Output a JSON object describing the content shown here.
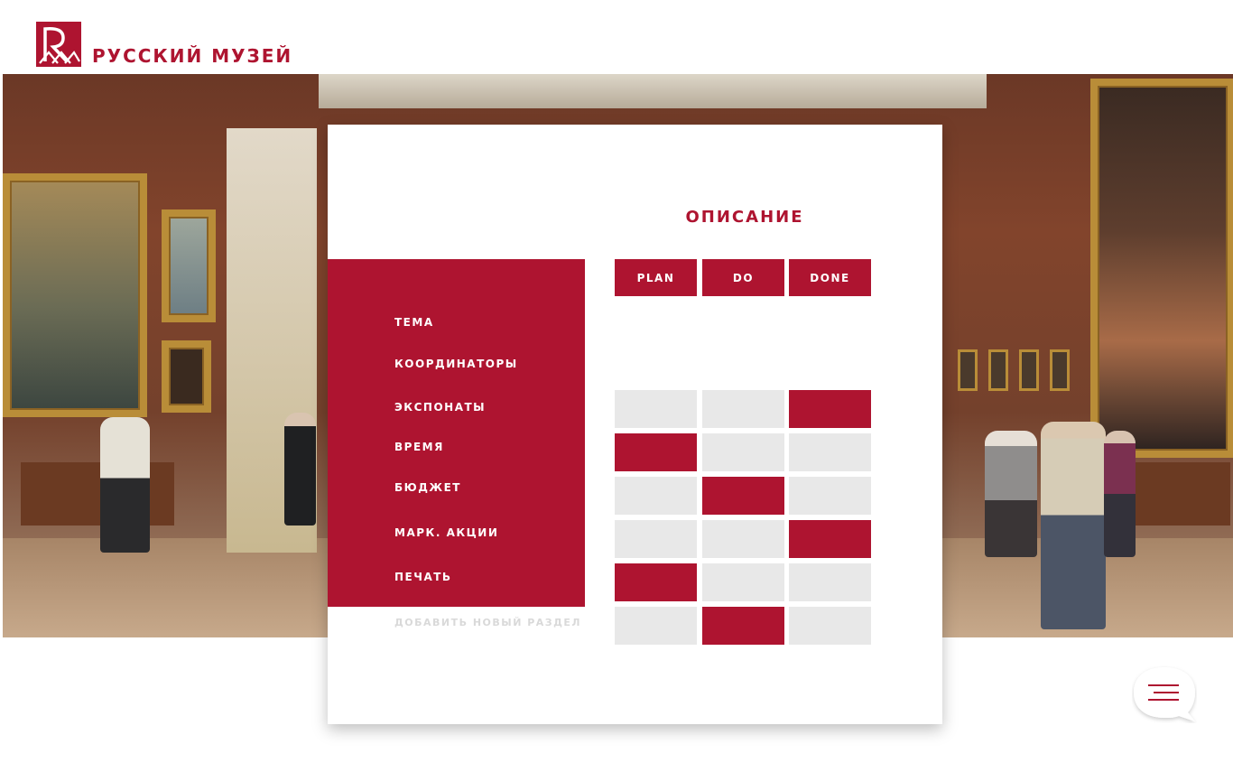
{
  "brand": {
    "name": "РУССКИЙ МУЗЕЙ",
    "logo_icon": "russian-museum-logo-icon",
    "accent": "#ae1430"
  },
  "card": {
    "title": "ОПИСАНИЕ"
  },
  "columns": [
    {
      "label": "PLAN"
    },
    {
      "label": "DO"
    },
    {
      "label": "DONE"
    }
  ],
  "sections": [
    {
      "label": "ТЕМА"
    },
    {
      "label": "КООРДИНАТОРЫ"
    },
    {
      "label": "ЭКСПОНАТЫ"
    },
    {
      "label": "ВРЕМЯ"
    },
    {
      "label": "БЮДЖЕТ"
    },
    {
      "label": "МАРК. АКЦИИ"
    },
    {
      "label": "ПЕЧАТЬ"
    }
  ],
  "add_section_label": "ДОБАВИТЬ НОВЫЙ РАЗДЕЛ",
  "status_grid": {
    "colors": {
      "active": "#ae1430",
      "inactive": "#e8e8e8"
    },
    "rows": [
      {
        "active_column": "DONE"
      },
      {
        "active_column": "PLAN"
      },
      {
        "active_column": "DO"
      },
      {
        "active_column": "DONE"
      },
      {
        "active_column": "PLAN"
      },
      {
        "active_column": "DO"
      }
    ]
  },
  "chat_button": {
    "icon": "menu-chat-icon"
  }
}
